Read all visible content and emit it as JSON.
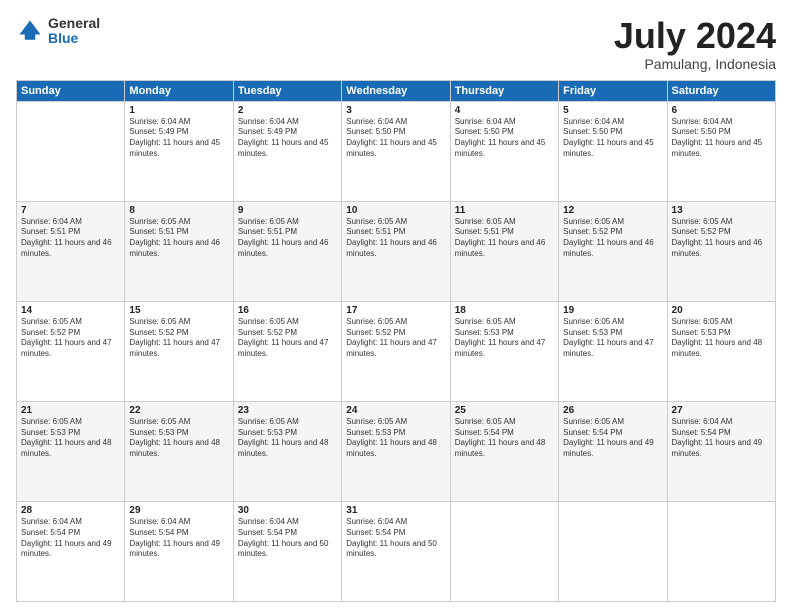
{
  "logo": {
    "general": "General",
    "blue": "Blue"
  },
  "header": {
    "month": "July 2024",
    "location": "Pamulang, Indonesia"
  },
  "weekdays": [
    "Sunday",
    "Monday",
    "Tuesday",
    "Wednesday",
    "Thursday",
    "Friday",
    "Saturday"
  ],
  "weeks": [
    [
      {
        "day": "",
        "sunrise": "",
        "sunset": "",
        "daylight": ""
      },
      {
        "day": "1",
        "sunrise": "Sunrise: 6:04 AM",
        "sunset": "Sunset: 5:49 PM",
        "daylight": "Daylight: 11 hours and 45 minutes."
      },
      {
        "day": "2",
        "sunrise": "Sunrise: 6:04 AM",
        "sunset": "Sunset: 5:49 PM",
        "daylight": "Daylight: 11 hours and 45 minutes."
      },
      {
        "day": "3",
        "sunrise": "Sunrise: 6:04 AM",
        "sunset": "Sunset: 5:50 PM",
        "daylight": "Daylight: 11 hours and 45 minutes."
      },
      {
        "day": "4",
        "sunrise": "Sunrise: 6:04 AM",
        "sunset": "Sunset: 5:50 PM",
        "daylight": "Daylight: 11 hours and 45 minutes."
      },
      {
        "day": "5",
        "sunrise": "Sunrise: 6:04 AM",
        "sunset": "Sunset: 5:50 PM",
        "daylight": "Daylight: 11 hours and 45 minutes."
      },
      {
        "day": "6",
        "sunrise": "Sunrise: 6:04 AM",
        "sunset": "Sunset: 5:50 PM",
        "daylight": "Daylight: 11 hours and 45 minutes."
      }
    ],
    [
      {
        "day": "7",
        "sunrise": "Sunrise: 6:04 AM",
        "sunset": "Sunset: 5:51 PM",
        "daylight": "Daylight: 11 hours and 46 minutes."
      },
      {
        "day": "8",
        "sunrise": "Sunrise: 6:05 AM",
        "sunset": "Sunset: 5:51 PM",
        "daylight": "Daylight: 11 hours and 46 minutes."
      },
      {
        "day": "9",
        "sunrise": "Sunrise: 6:05 AM",
        "sunset": "Sunset: 5:51 PM",
        "daylight": "Daylight: 11 hours and 46 minutes."
      },
      {
        "day": "10",
        "sunrise": "Sunrise: 6:05 AM",
        "sunset": "Sunset: 5:51 PM",
        "daylight": "Daylight: 11 hours and 46 minutes."
      },
      {
        "day": "11",
        "sunrise": "Sunrise: 6:05 AM",
        "sunset": "Sunset: 5:51 PM",
        "daylight": "Daylight: 11 hours and 46 minutes."
      },
      {
        "day": "12",
        "sunrise": "Sunrise: 6:05 AM",
        "sunset": "Sunset: 5:52 PM",
        "daylight": "Daylight: 11 hours and 46 minutes."
      },
      {
        "day": "13",
        "sunrise": "Sunrise: 6:05 AM",
        "sunset": "Sunset: 5:52 PM",
        "daylight": "Daylight: 11 hours and 46 minutes."
      }
    ],
    [
      {
        "day": "14",
        "sunrise": "Sunrise: 6:05 AM",
        "sunset": "Sunset: 5:52 PM",
        "daylight": "Daylight: 11 hours and 47 minutes."
      },
      {
        "day": "15",
        "sunrise": "Sunrise: 6:05 AM",
        "sunset": "Sunset: 5:52 PM",
        "daylight": "Daylight: 11 hours and 47 minutes."
      },
      {
        "day": "16",
        "sunrise": "Sunrise: 6:05 AM",
        "sunset": "Sunset: 5:52 PM",
        "daylight": "Daylight: 11 hours and 47 minutes."
      },
      {
        "day": "17",
        "sunrise": "Sunrise: 6:05 AM",
        "sunset": "Sunset: 5:52 PM",
        "daylight": "Daylight: 11 hours and 47 minutes."
      },
      {
        "day": "18",
        "sunrise": "Sunrise: 6:05 AM",
        "sunset": "Sunset: 5:53 PM",
        "daylight": "Daylight: 11 hours and 47 minutes."
      },
      {
        "day": "19",
        "sunrise": "Sunrise: 6:05 AM",
        "sunset": "Sunset: 5:53 PM",
        "daylight": "Daylight: 11 hours and 47 minutes."
      },
      {
        "day": "20",
        "sunrise": "Sunrise: 6:05 AM",
        "sunset": "Sunset: 5:53 PM",
        "daylight": "Daylight: 11 hours and 48 minutes."
      }
    ],
    [
      {
        "day": "21",
        "sunrise": "Sunrise: 6:05 AM",
        "sunset": "Sunset: 5:53 PM",
        "daylight": "Daylight: 11 hours and 48 minutes."
      },
      {
        "day": "22",
        "sunrise": "Sunrise: 6:05 AM",
        "sunset": "Sunset: 5:53 PM",
        "daylight": "Daylight: 11 hours and 48 minutes."
      },
      {
        "day": "23",
        "sunrise": "Sunrise: 6:05 AM",
        "sunset": "Sunset: 5:53 PM",
        "daylight": "Daylight: 11 hours and 48 minutes."
      },
      {
        "day": "24",
        "sunrise": "Sunrise: 6:05 AM",
        "sunset": "Sunset: 5:53 PM",
        "daylight": "Daylight: 11 hours and 48 minutes."
      },
      {
        "day": "25",
        "sunrise": "Sunrise: 6:05 AM",
        "sunset": "Sunset: 5:54 PM",
        "daylight": "Daylight: 11 hours and 48 minutes."
      },
      {
        "day": "26",
        "sunrise": "Sunrise: 6:05 AM",
        "sunset": "Sunset: 5:54 PM",
        "daylight": "Daylight: 11 hours and 49 minutes."
      },
      {
        "day": "27",
        "sunrise": "Sunrise: 6:04 AM",
        "sunset": "Sunset: 5:54 PM",
        "daylight": "Daylight: 11 hours and 49 minutes."
      }
    ],
    [
      {
        "day": "28",
        "sunrise": "Sunrise: 6:04 AM",
        "sunset": "Sunset: 5:54 PM",
        "daylight": "Daylight: 11 hours and 49 minutes."
      },
      {
        "day": "29",
        "sunrise": "Sunrise: 6:04 AM",
        "sunset": "Sunset: 5:54 PM",
        "daylight": "Daylight: 11 hours and 49 minutes."
      },
      {
        "day": "30",
        "sunrise": "Sunrise: 6:04 AM",
        "sunset": "Sunset: 5:54 PM",
        "daylight": "Daylight: 11 hours and 50 minutes."
      },
      {
        "day": "31",
        "sunrise": "Sunrise: 6:04 AM",
        "sunset": "Sunset: 5:54 PM",
        "daylight": "Daylight: 11 hours and 50 minutes."
      },
      {
        "day": "",
        "sunrise": "",
        "sunset": "",
        "daylight": ""
      },
      {
        "day": "",
        "sunrise": "",
        "sunset": "",
        "daylight": ""
      },
      {
        "day": "",
        "sunrise": "",
        "sunset": "",
        "daylight": ""
      }
    ]
  ]
}
